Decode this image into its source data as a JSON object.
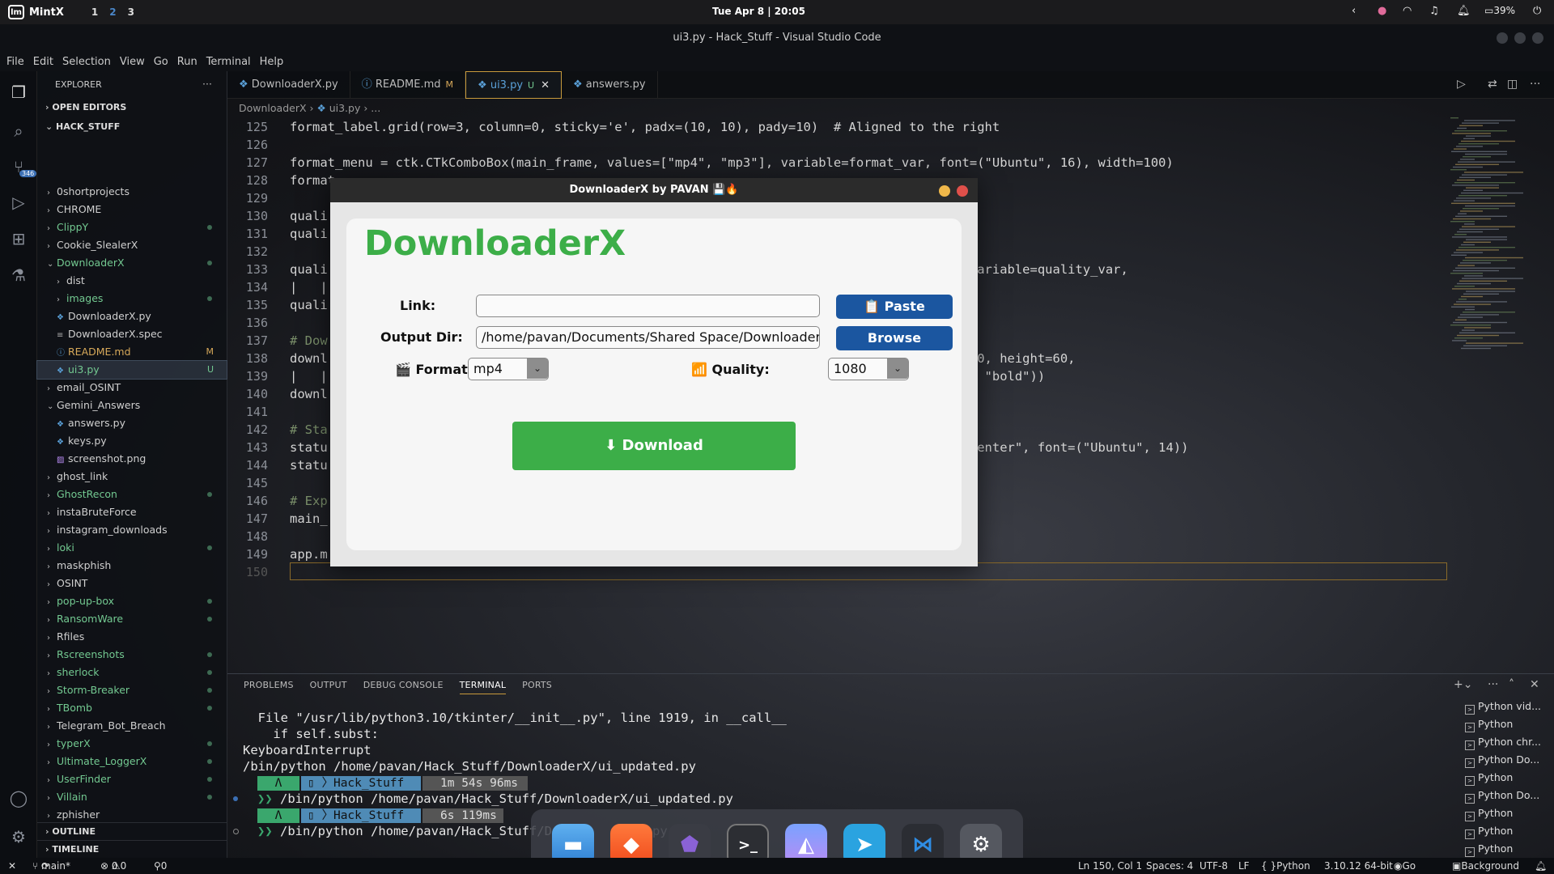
{
  "topbar": {
    "os": "MintX",
    "workspaces": [
      "1",
      "2",
      "3"
    ],
    "clock": "Tue Apr 8 | 20:05",
    "battery": "39%"
  },
  "window_title": "ui3.py - Hack_Stuff - Visual Studio Code",
  "menu": [
    "File",
    "Edit",
    "Selection",
    "View",
    "Go",
    "Run",
    "Terminal",
    "Help"
  ],
  "activity": {
    "scm_badge": "346"
  },
  "explorer": {
    "title": "EXPLORER",
    "open_editors": "OPEN EDITORS",
    "root": "HACK_STUFF",
    "items": [
      {
        "label": "0shortprojects",
        "kind": "folder",
        "status": ""
      },
      {
        "label": "CHROME",
        "kind": "folder",
        "status": ""
      },
      {
        "label": "ClippY",
        "kind": "folder",
        "status": "dot"
      },
      {
        "label": "Cookie_SlealerX",
        "kind": "folder",
        "status": ""
      },
      {
        "label": "DownloaderX",
        "kind": "folder-open",
        "status": "dot"
      },
      {
        "label": "dist",
        "kind": "folder",
        "status": ""
      },
      {
        "label": "images",
        "kind": "folder",
        "status": "dot"
      },
      {
        "label": "DownloaderX.py",
        "kind": "py",
        "status": ""
      },
      {
        "label": "DownloaderX.spec",
        "kind": "file",
        "status": ""
      },
      {
        "label": "README.md",
        "kind": "md",
        "status": "M"
      },
      {
        "label": "ui3.py",
        "kind": "py",
        "status": "U"
      },
      {
        "label": "email_OSINT",
        "kind": "folder",
        "status": ""
      },
      {
        "label": "Gemini_Answers",
        "kind": "folder-open",
        "status": ""
      },
      {
        "label": "answers.py",
        "kind": "py",
        "status": ""
      },
      {
        "label": "keys.py",
        "kind": "py",
        "status": ""
      },
      {
        "label": "screenshot.png",
        "kind": "img",
        "status": ""
      },
      {
        "label": "ghost_link",
        "kind": "folder",
        "status": ""
      },
      {
        "label": "GhostRecon",
        "kind": "folder",
        "status": "dot"
      },
      {
        "label": "instaBruteForce",
        "kind": "folder",
        "status": ""
      },
      {
        "label": "instagram_downloads",
        "kind": "folder",
        "status": ""
      },
      {
        "label": "loki",
        "kind": "folder",
        "status": "dot"
      },
      {
        "label": "maskphish",
        "kind": "folder",
        "status": ""
      },
      {
        "label": "OSINT",
        "kind": "folder",
        "status": ""
      },
      {
        "label": "pop-up-box",
        "kind": "folder",
        "status": "dot"
      },
      {
        "label": "RansomWare",
        "kind": "folder",
        "status": "dot"
      },
      {
        "label": "Rfiles",
        "kind": "folder",
        "status": ""
      },
      {
        "label": "Rscreenshots",
        "kind": "folder",
        "status": "dot"
      },
      {
        "label": "sherlock",
        "kind": "folder",
        "status": "dot"
      },
      {
        "label": "Storm-Breaker",
        "kind": "folder",
        "status": "dot"
      },
      {
        "label": "TBomb",
        "kind": "folder",
        "status": "dot"
      },
      {
        "label": "Telegram_Bot_Breach",
        "kind": "folder",
        "status": ""
      },
      {
        "label": "typerX",
        "kind": "folder",
        "status": "dot"
      },
      {
        "label": "Ultimate_LoggerX",
        "kind": "folder",
        "status": "dot"
      },
      {
        "label": "UserFinder",
        "kind": "folder",
        "status": "dot"
      },
      {
        "label": "Villain",
        "kind": "folder",
        "status": "dot"
      },
      {
        "label": "zphisher",
        "kind": "folder",
        "status": ""
      }
    ],
    "outline": "OUTLINE",
    "timeline": "TIMELINE"
  },
  "tabs": [
    {
      "label": "DownloaderX.py",
      "badge": ""
    },
    {
      "label": "README.md",
      "badge": "M"
    },
    {
      "label": "ui3.py",
      "badge": "U"
    },
    {
      "label": "answers.py",
      "badge": ""
    }
  ],
  "breadcrumb": [
    "DownloaderX",
    "ui3.py",
    "..."
  ],
  "code_lines": [
    {
      "n": "125",
      "t": "format_label.grid(row=3, column=0, sticky='e', padx=(10, 10), pady=10)  # Aligned to the right"
    },
    {
      "n": "126",
      "t": ""
    },
    {
      "n": "127",
      "t": "format_menu = ctk.CTkComboBox(main_frame, values=[\"mp4\", \"mp3\"], variable=format_var, font=(\"Ubuntu\", 16), width=100)"
    },
    {
      "n": "128",
      "t": "format"
    },
    {
      "n": "129",
      "t": ""
    },
    {
      "n": "130",
      "t": "quali"
    },
    {
      "n": "131",
      "t": "quali                                                                                  p"
    },
    {
      "n": "132",
      "t": ""
    },
    {
      "n": "133",
      "t": "quali                                                                              080\"], variable=quality_var,"
    },
    {
      "n": "134",
      "t": "|   |"
    },
    {
      "n": "135",
      "t": "quali"
    },
    {
      "n": "136",
      "t": ""
    },
    {
      "n": "137",
      "t": "# Dow"
    },
    {
      "n": "138",
      "t": "downl                                                                               idth=350, height=60,"
    },
    {
      "n": "139",
      "t": "|   |                                                                               u\", 18, \"bold\"))"
    },
    {
      "n": "140",
      "t": "downl"
    },
    {
      "n": "141",
      "t": ""
    },
    {
      "n": "142",
      "t": "# Sta"
    },
    {
      "n": "143",
      "t": "statu                                                                               tify=\"center\", font=(\"Ubuntu\", 14))"
    },
    {
      "n": "144",
      "t": "statu"
    },
    {
      "n": "145",
      "t": ""
    },
    {
      "n": "146",
      "t": "# Exp"
    },
    {
      "n": "147",
      "t": "main_"
    },
    {
      "n": "148",
      "t": ""
    },
    {
      "n": "149",
      "t": "app.m"
    },
    {
      "n": "150",
      "t": ""
    }
  ],
  "panel": {
    "tabs": [
      "PROBLEMS",
      "OUTPUT",
      "DEBUG CONSOLE",
      "TERMINAL",
      "PORTS"
    ],
    "active": "TERMINAL",
    "lines": [
      "  File \"/usr/lib/python3.10/tkinter/__init__.py\", line 1919, in __call__",
      "    if self.subst:",
      "KeyboardInterrupt",
      "/bin/python /home/pavan/Hack_Stuff/DownloaderX/ui_updated.py"
    ],
    "prompt1": {
      "dir": "Hack_Stuff",
      "time": "1m 54s 96ms",
      "cmd": "/bin/python /home/pavan/Hack_Stuff/DownloaderX/ui_updated.py"
    },
    "prompt2": {
      "dir": "Hack_Stuff",
      "time": "6s 119ms",
      "cmd": "/bin/python /home/pavan/Hack_Stuff/Dow",
      "cmd_tail": "er",
      "cmd_tail2": "py"
    },
    "term_list": [
      "Python vid...",
      "Python",
      "Python chr...",
      "Python Do...",
      "Python",
      "Python Do...",
      "Python",
      "Python",
      "Python"
    ]
  },
  "status": {
    "branch": "main*",
    "errors": "0",
    "warnings": "0",
    "ports": "0",
    "position": "Ln 150, Col 1",
    "spaces": "Spaces: 4",
    "encoding": "UTF-8",
    "eol": "LF",
    "lang": "Python",
    "interp": "3.10.12 64-bit",
    "golive": "Go Live",
    "background": "Background"
  },
  "dl": {
    "title": "DownloaderX by PAVAN 💾🔥",
    "heading": "DownloaderX",
    "link_label": "Link:",
    "link_value": "",
    "paste": "📋 Paste",
    "outdir_label": "Output Dir:",
    "outdir_value": "/home/pavan/Documents/Shared Space/DownloaderX",
    "browse": "Browse",
    "format_label": "🎬 Format:",
    "format_value": "mp4",
    "quality_label": "📶 Quality:",
    "quality_value": "1080",
    "download": "⬇ Download"
  },
  "colors": {
    "accent_green": "#3cae48",
    "button_blue": "#1b56a0",
    "tab_border": "#c89a3c"
  }
}
